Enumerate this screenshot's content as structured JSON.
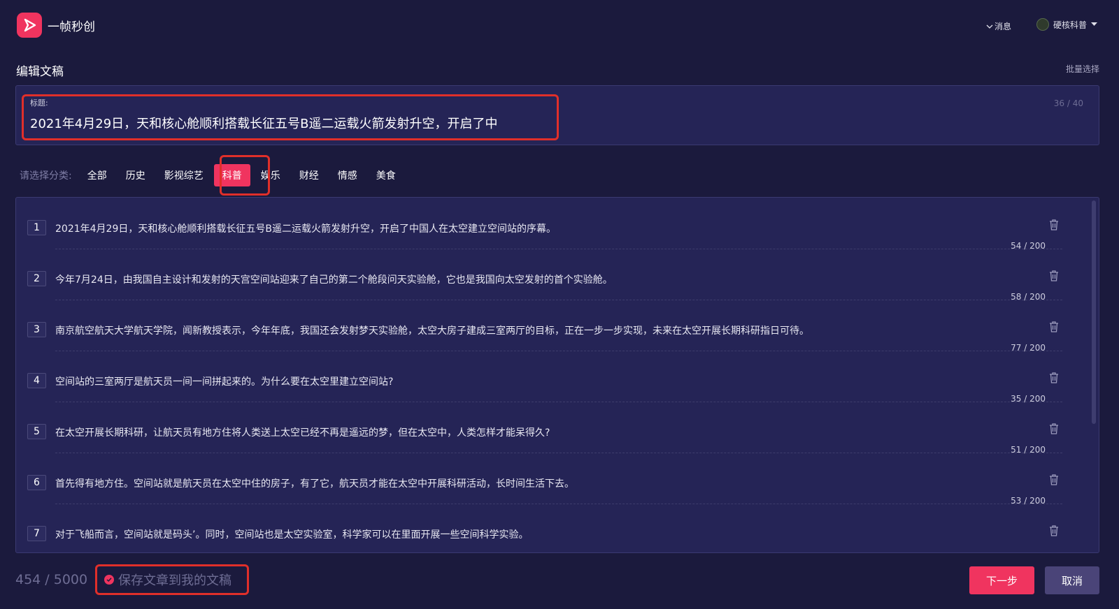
{
  "app": {
    "brand": "一帧秒创",
    "accent": "#f0345f"
  },
  "header": {
    "messages_label": "消息",
    "user_name": "硬核科普"
  },
  "page": {
    "section_title": "编辑文稿",
    "batch_select": "批量选择"
  },
  "title_field": {
    "label": "标题:",
    "value": "2021年4月29日，天和核心舱顺利搭载长征五号B遥二运载火箭发射升空，开启了中",
    "count": "36 / 40"
  },
  "categories": {
    "label": "请选择分类:",
    "items": [
      "全部",
      "历史",
      "影视综艺",
      "科普",
      "娱乐",
      "财经",
      "情感",
      "美食"
    ],
    "selected": "科普"
  },
  "paragraphs": [
    {
      "num": "1",
      "text": "2021年4月29日，天和核心舱顺利搭载长征五号B遥二运载火箭发射升空，开启了中国人在太空建立空间站的序幕。",
      "count": "54 / 200"
    },
    {
      "num": "2",
      "text": "今年7月24日，由我国自主设计和发射的天宫空间站迎来了自己的第二个舱段问天实验舱，它也是我国向太空发射的首个实验舱。",
      "count": "58 / 200"
    },
    {
      "num": "3",
      "text": "南京航空航天大学航天学院，闻新教授表示，今年年底，我国还会发射梦天实验舱，太空大房子建成三室两厅的目标，正在一步一步实现，未来在太空开展长期科研指日可待。",
      "count": "77 / 200"
    },
    {
      "num": "4",
      "text": "空间站的三室两厅是航天员一间一间拼起来的。为什么要在太空里建立空间站?",
      "count": "35 / 200"
    },
    {
      "num": "5",
      "text": "在太空开展长期科研，让航天员有地方住将人类送上太空已经不再是遥远的梦，但在太空中，人类怎样才能呆得久?",
      "count": "51 / 200"
    },
    {
      "num": "6",
      "text": "首先得有地方住。空间站就是航天员在太空中住的房子，有了它，航天员才能在太空中开展科研活动，长时间生活下去。",
      "count": "53 / 200"
    },
    {
      "num": "7",
      "text": "对于飞船而言，空间站就是码头’。同时，空间站也是太空实验室，科学家可以在里面开展一些空间科学实验。",
      "count": ""
    }
  ],
  "footer": {
    "total_count": "454 / 5000",
    "save_label": "保存文章到我的文稿",
    "next_label": "下一步",
    "cancel_label": "取消"
  }
}
